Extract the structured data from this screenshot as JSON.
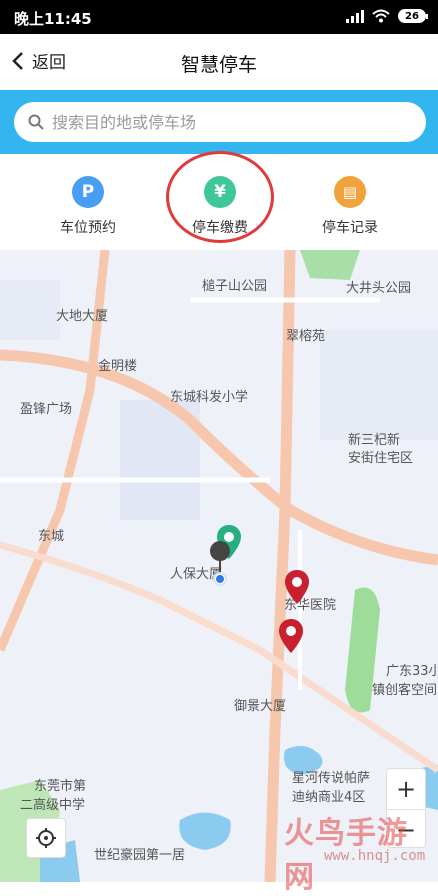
{
  "status_bar": {
    "time": "晚上11:45",
    "battery": "26"
  },
  "header": {
    "back_label": "返回",
    "title": "智慧停车"
  },
  "search": {
    "placeholder": "搜索目的地或停车场"
  },
  "quick_actions": [
    {
      "label": "车位预约",
      "glyph": "P",
      "color": "#4a9ef0",
      "icon": "parking-icon"
    },
    {
      "label": "停车缴费",
      "glyph": "¥",
      "color": "#3ec79a",
      "icon": "yen-icon"
    },
    {
      "label": "停车记录",
      "glyph": "▤",
      "color": "#f2a23a",
      "icon": "record-icon"
    }
  ],
  "map": {
    "labels": [
      "槌子山公园",
      "大井头公园",
      "大地大厦",
      "翠榕苑",
      "金明楼",
      "东城科发小学",
      "盈锋广场",
      "新三杞新",
      "安街住宅区",
      "东城",
      "人保大厦",
      "东华医院",
      "广东33小",
      "镇创客空间",
      "御景大厦",
      "东莞市第",
      "二高级中学",
      "星河传说帕萨",
      "迪纳商业4区",
      "世纪豪园第一居"
    ]
  },
  "controls": {
    "zoom_in": "+",
    "zoom_out": "−"
  },
  "watermark": {
    "main": "火鸟手游网",
    "url": "www.hnqj.com"
  }
}
